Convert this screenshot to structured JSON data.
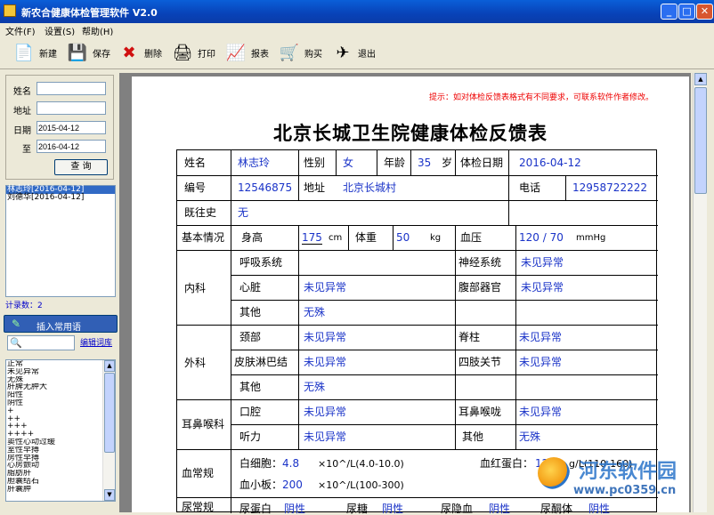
{
  "window": {
    "title": "新农合健康体检管理软件 V2.0",
    "min": "_",
    "max": "□",
    "close": "✕"
  },
  "menu": [
    "文件(F)",
    "设置(S)",
    "帮助(H)"
  ],
  "toolbar": [
    {
      "label": "新建",
      "icon": "new-document-icon",
      "glyph": "📄"
    },
    {
      "label": "保存",
      "icon": "save-icon",
      "glyph": "💾"
    },
    {
      "label": "删除",
      "icon": "delete-icon",
      "glyph": "✖"
    },
    {
      "label": "打印",
      "icon": "print-icon",
      "glyph": "🖨"
    },
    {
      "label": "报表",
      "icon": "report-icon",
      "glyph": "📈"
    },
    {
      "label": "购买",
      "icon": "buy-icon",
      "glyph": "🛒"
    },
    {
      "label": "退出",
      "icon": "exit-icon",
      "glyph": "✈"
    }
  ],
  "search_form": {
    "name_label": "姓名",
    "name_value": "",
    "address_label": "地址",
    "address_value": "",
    "date_label": "日期",
    "date_from": "2015-04-12",
    "to_label": "至",
    "date_to": "2016-04-12",
    "query_button": "查 询"
  },
  "records": [
    {
      "text": "林志玲[2016-04-12]",
      "selected": true
    },
    {
      "text": "刘德华[2016-04-12]",
      "selected": false
    }
  ],
  "record_count": "计录数：2",
  "insert_phrase_button": "插入常用语",
  "edit_phrases_link": "编辑词库",
  "phrases": [
    "正常",
    "未见异常",
    "无殊",
    "肝脾无肿大",
    "阳性",
    "阴性",
    "+",
    "++",
    "+++",
    "++++",
    "窦性心动过缓",
    "室性早搏",
    "房性早搏",
    "心房颤动",
    "脂肪肝",
    "胆囊结石",
    "肝囊肿"
  ],
  "report": {
    "note": "提示：如对体检反馈表格式有不同要求，可联系软件作者修改。",
    "title": "北京长城卫生院健康体检反馈表",
    "name_label": "姓名",
    "name": "林志玲",
    "sex_label": "性别",
    "sex": "女",
    "age_label": "年龄",
    "age": "35",
    "age_unit": "岁",
    "date_label": "体检日期",
    "date": "2016-04-12",
    "id_label": "编号",
    "id": "12546875",
    "addr_label": "地址",
    "addr": "北京长城村",
    "phone_label": "电话",
    "phone": "12958722222",
    "history_label": "既往史",
    "history": "无",
    "basic_label": "基本情况",
    "height_label": "身高",
    "height": "175",
    "height_unit": "cm",
    "weight_label": "体重",
    "weight": "50",
    "weight_unit": "kg",
    "bp_label": "血压",
    "bp": "120 / 70",
    "bp_unit": "mmHg",
    "internal_label": "内科",
    "resp_label": "呼吸系统",
    "resp": "",
    "neuro_label": "神经系统",
    "neuro": "未见异常",
    "heart_label": "心脏",
    "heart": "未见异常",
    "abd_label": "腹部器官",
    "abd": "未见异常",
    "int_other_label": "其他",
    "int_other": "无殊",
    "surgery_label": "外科",
    "neck_label": "颈部",
    "neck": "未见异常",
    "spine_label": "脊柱",
    "spine": "未见异常",
    "lymph_label": "皮肤淋巴结",
    "lymph": "未见异常",
    "limbs_label": "四肢关节",
    "limbs": "未见异常",
    "sur_other_label": "其他",
    "sur_other": "无殊",
    "ent_label": "耳鼻喉科",
    "mouth_label": "口腔",
    "mouth": "未见异常",
    "ent2_label": "耳鼻喉咙",
    "ent2": "未见异常",
    "hearing_label": "听力",
    "hearing": "未见异常",
    "ent_other_label": "其他",
    "ent_other": "无殊",
    "blood_label": "血常规",
    "wbc_label": "白细胞：",
    "wbc": "4.8",
    "wbc_ref": "×10^/L(4.0-10.0)",
    "hb_label": "血红蛋白：",
    "hb": "120",
    "hb_ref": "g/L(110-160)",
    "plt_label": "血小板：",
    "plt": "200",
    "plt_ref": "×10^/L(100-300)",
    "urine_label": "尿常规",
    "u1_label": "尿蛋白",
    "u1": "阴性",
    "u2_label": "尿糖",
    "u2": "阴性",
    "u3_label": "尿隐血",
    "u3": "阴性",
    "u4_label": "尿酮体",
    "u4": "阴性"
  },
  "watermark": {
    "brand": "河东软件园",
    "url": "www.pc0359.cn"
  }
}
